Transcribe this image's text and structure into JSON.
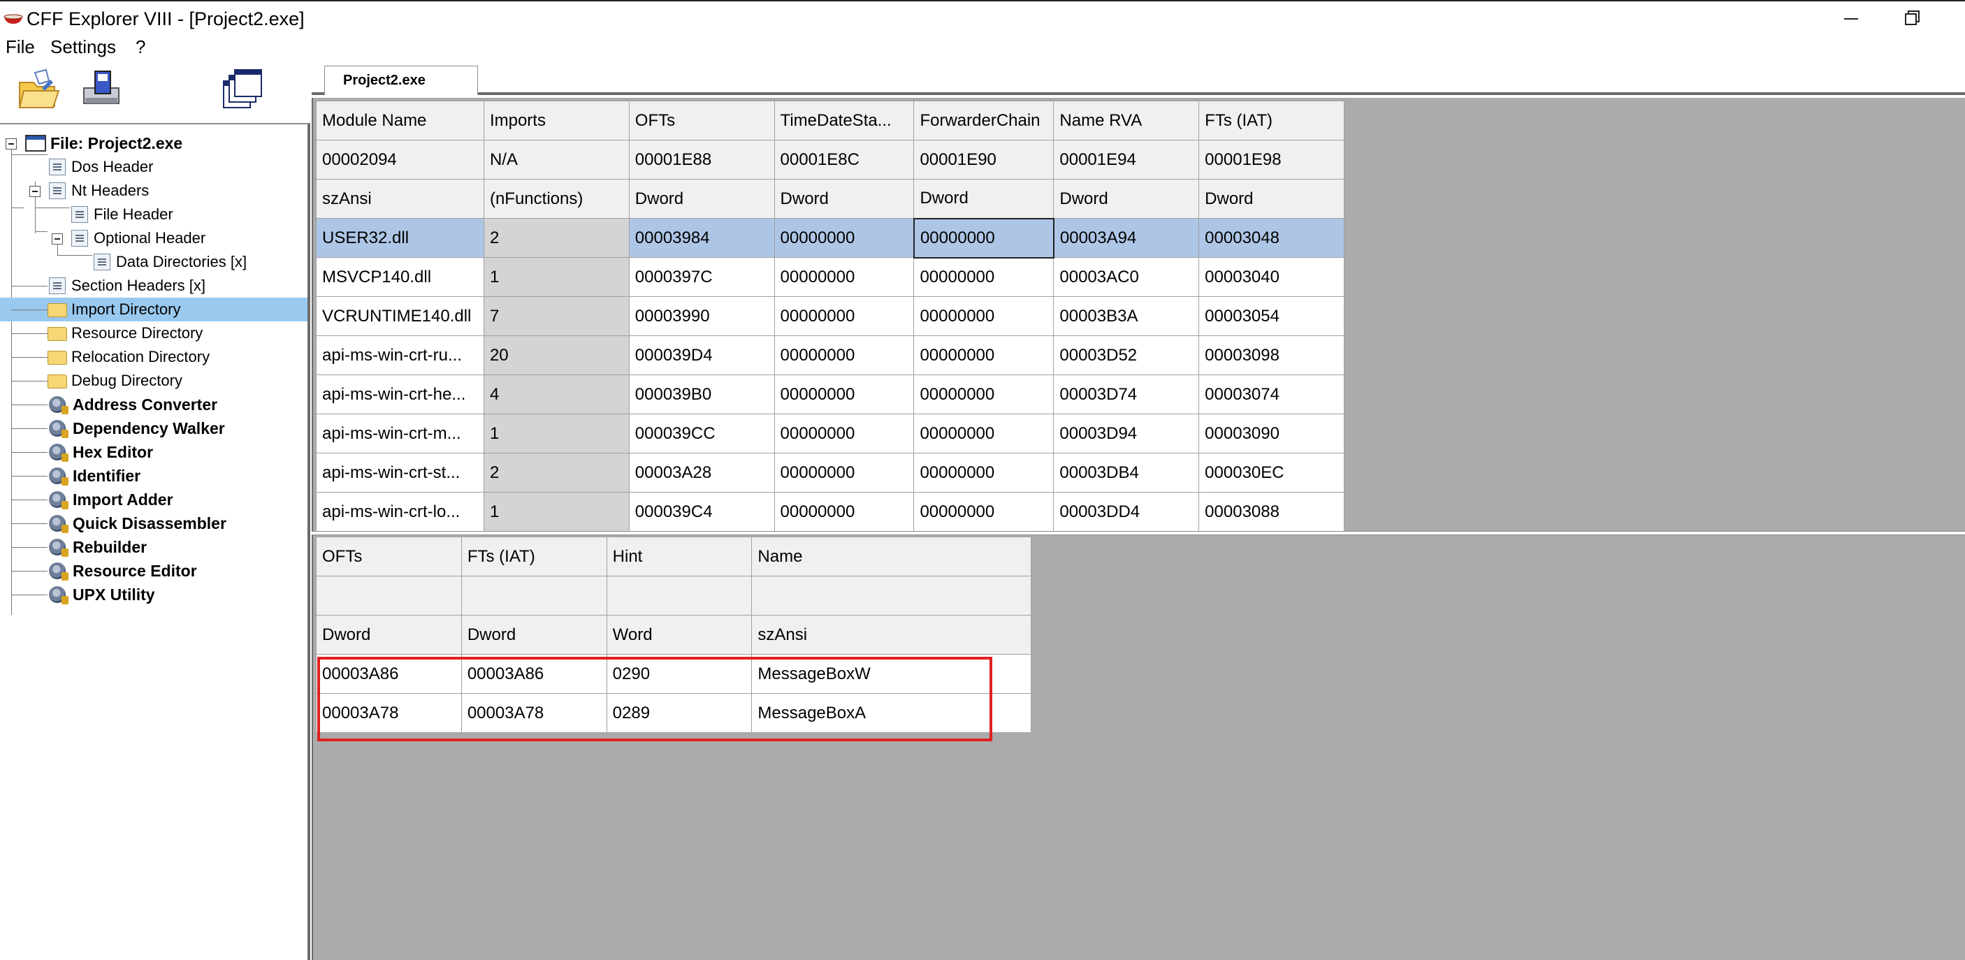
{
  "window": {
    "title": "CFF Explorer VIII - [Project2.exe]"
  },
  "menu": {
    "items": [
      "File",
      "Settings",
      "?"
    ]
  },
  "toolbar": {
    "icons": [
      "open-file-icon",
      "save-icon",
      "windows-icon"
    ]
  },
  "tree": {
    "items": [
      {
        "label": "File: Project2.exe",
        "icon": "file-icon"
      },
      {
        "label": "Dos Header",
        "icon": "page-icon"
      },
      {
        "label": "Nt Headers",
        "icon": "page-icon"
      },
      {
        "label": "File Header",
        "icon": "page-icon"
      },
      {
        "label": "Optional Header",
        "icon": "page-icon"
      },
      {
        "label": "Data Directories [x]",
        "icon": "page-icon"
      },
      {
        "label": "Section Headers [x]",
        "icon": "page-icon"
      },
      {
        "label": "Import Directory",
        "icon": "folder-icon",
        "selected": true
      },
      {
        "label": "Resource Directory",
        "icon": "folder-icon"
      },
      {
        "label": "Relocation Directory",
        "icon": "folder-icon"
      },
      {
        "label": "Debug Directory",
        "icon": "folder-icon"
      },
      {
        "label": "Address Converter",
        "icon": "tool-icon"
      },
      {
        "label": "Dependency Walker",
        "icon": "tool-icon"
      },
      {
        "label": "Hex Editor",
        "icon": "tool-icon"
      },
      {
        "label": "Identifier",
        "icon": "tool-icon"
      },
      {
        "label": "Import Adder",
        "icon": "tool-icon"
      },
      {
        "label": "Quick Disassembler",
        "icon": "tool-icon"
      },
      {
        "label": "Rebuilder",
        "icon": "tool-icon"
      },
      {
        "label": "Resource Editor",
        "icon": "tool-icon"
      },
      {
        "label": "UPX Utility",
        "icon": "tool-icon"
      }
    ]
  },
  "tab": {
    "label": "Project2.exe"
  },
  "imports_table": {
    "headers": [
      "Module Name",
      "Imports",
      "OFTs",
      "TimeDateSta...",
      "ForwarderChain",
      "Name RVA",
      "FTs (IAT)"
    ],
    "offsets": [
      "00002094",
      "N/A",
      "00001E88",
      "00001E8C",
      "00001E90",
      "00001E94",
      "00001E98"
    ],
    "types": [
      "szAnsi",
      "(nFunctions)",
      "Dword",
      "Dword",
      "Dword",
      "Dword",
      "Dword"
    ],
    "rows": [
      [
        "USER32.dll",
        "2",
        "00003984",
        "00000000",
        "00000000",
        "00003A94",
        "00003048"
      ],
      [
        "MSVCP140.dll",
        "1",
        "0000397C",
        "00000000",
        "00000000",
        "00003AC0",
        "00003040"
      ],
      [
        "VCRUNTIME140.dll",
        "7",
        "00003990",
        "00000000",
        "00000000",
        "00003B3A",
        "00003054"
      ],
      [
        "api-ms-win-crt-ru...",
        "20",
        "000039D4",
        "00000000",
        "00000000",
        "00003D52",
        "00003098"
      ],
      [
        "api-ms-win-crt-he...",
        "4",
        "000039B0",
        "00000000",
        "00000000",
        "00003D74",
        "00003074"
      ],
      [
        "api-ms-win-crt-m...",
        "1",
        "000039CC",
        "00000000",
        "00000000",
        "00003D94",
        "00003090"
      ],
      [
        "api-ms-win-crt-st...",
        "2",
        "00003A28",
        "00000000",
        "00000000",
        "00003DB4",
        "000030EC"
      ],
      [
        "api-ms-win-crt-lo...",
        "1",
        "000039C4",
        "00000000",
        "00000000",
        "00003DD4",
        "00003088"
      ]
    ],
    "selected_row": 0
  },
  "functions_table": {
    "headers": [
      "OFTs",
      "FTs (IAT)",
      "Hint",
      "Name"
    ],
    "offsets": [
      "",
      "",
      "",
      ""
    ],
    "types": [
      "Dword",
      "Dword",
      "Word",
      "szAnsi"
    ],
    "rows": [
      [
        "00003A86",
        "00003A86",
        "0290",
        "MessageBoxW"
      ],
      [
        "00003A78",
        "00003A78",
        "0289",
        "MessageBoxA"
      ]
    ]
  },
  "colors": {
    "selection": "#99c9ef",
    "row_highlight": "#aec6e6",
    "annotation_box": "#e02020",
    "workspace": "#ababab"
  }
}
